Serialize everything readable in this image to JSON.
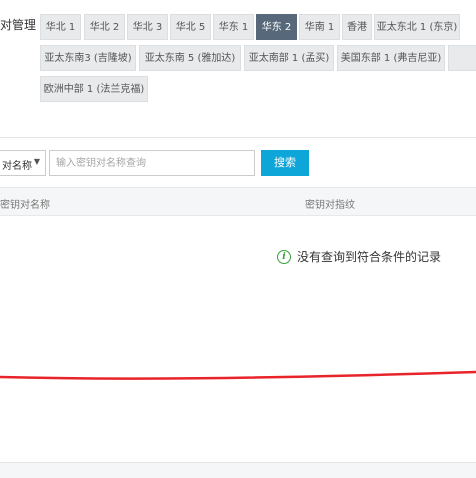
{
  "page_title": "对管理",
  "region_tabs": [
    {
      "label": "华北 1",
      "active": false
    },
    {
      "label": "华北 2",
      "active": false
    },
    {
      "label": "华北 3",
      "active": false
    },
    {
      "label": "华北 5",
      "active": false
    },
    {
      "label": "华东 1",
      "active": false
    },
    {
      "label": "华东 2",
      "active": true
    },
    {
      "label": "华南 1",
      "active": false
    },
    {
      "label": "香港",
      "active": false
    },
    {
      "label": "亚太东北 1 (东京)",
      "active": false
    },
    {
      "label": "亚太东南3 (吉隆坡)",
      "active": false
    },
    {
      "label": "亚太东南 5 (雅加达)",
      "active": false
    },
    {
      "label": "亚太南部 1 (孟买)",
      "active": false
    },
    {
      "label": "美国东部 1 (弗吉尼亚)",
      "active": false
    },
    {
      "label": "",
      "active": false
    },
    {
      "label": "欧洲中部 1 (法兰克福)",
      "active": false
    }
  ],
  "search": {
    "select_value": "对名称",
    "placeholder": "输入密钥对名称查询",
    "button_label": "搜索"
  },
  "table": {
    "columns": [
      "密钥对名称",
      "密钥对指纹"
    ],
    "empty_message": "没有查询到符合条件的记录"
  },
  "colors": {
    "active_tab": "#57687a",
    "search_button": "#0ea5d8",
    "info_icon": "#37a13a",
    "annotation_line": "#e8242a"
  },
  "icons": {
    "select_chevron": "chevron-down-icon",
    "empty_info": "info-icon"
  }
}
